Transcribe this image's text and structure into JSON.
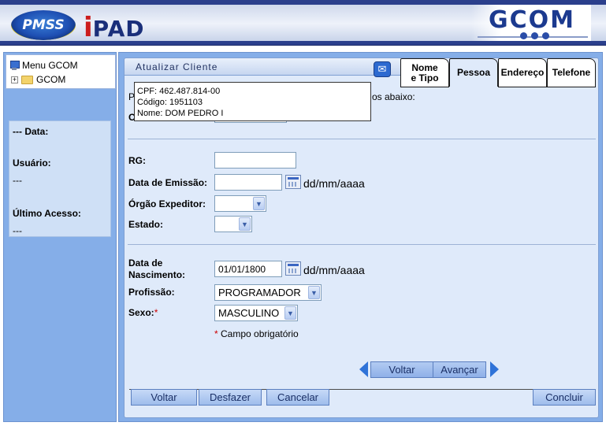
{
  "header": {
    "left_logo": "PMSS",
    "app_logo_i": "i",
    "app_logo_rest": "PAD",
    "right_logo": "GCOM"
  },
  "sidebar": {
    "tree": [
      {
        "label": "Menu GCOM",
        "icon": "computer-icon"
      },
      {
        "label": "GCOM",
        "icon": "folder-icon",
        "expander": "+"
      }
    ],
    "info": {
      "data_label": "--- Data:",
      "usuario_label": "Usuário:",
      "usuario_value": "---",
      "ultimo_label": "Último Acesso:",
      "ultimo_value": "---"
    }
  },
  "main": {
    "title": "Atualizar Cliente",
    "tabs": [
      {
        "label_line1": "Nome",
        "label_line2": "e Tipo"
      },
      {
        "label_line1": "Pessoa",
        "label_line2": ""
      },
      {
        "label_line1": "Endereço",
        "label_line2": ""
      },
      {
        "label_line1": "Telefone",
        "label_line2": ""
      }
    ],
    "active_tab": "Pessoa",
    "partial_intro_left": "P",
    "partial_intro_right": "os abaixo:",
    "partial_label_c": "C",
    "tooltip": {
      "cpf": "CPF: 462.487.814-00",
      "codigo": "Código: 1951103",
      "nome": "Nome: DOM PEDRO I"
    },
    "form": {
      "rg_label": "RG:",
      "rg_value": "",
      "emissao_label": "Data de Emissão:",
      "emissao_value": "",
      "emissao_hint": "dd/mm/aaaa",
      "orgao_label": "Órgão Expeditor:",
      "orgao_value": "",
      "estado_label": "Estado:",
      "estado_value": "",
      "nascimento_label_1": "Data de",
      "nascimento_label_2": "Nascimento:",
      "nascimento_value": "01/01/1800",
      "nascimento_hint": "dd/mm/aaaa",
      "profissao_label": "Profissão:",
      "profissao_value": "PROGRAMADOR",
      "sexo_label": "Sexo:",
      "sexo_required": "*",
      "sexo_value": "MASCULINO",
      "required_note_star": "*",
      "required_note": "Campo obrigatório"
    },
    "wizard_buttons": {
      "back": "Voltar",
      "next": "Avançar"
    },
    "bottom_buttons": {
      "voltar": "Voltar",
      "desfazer": "Desfazer",
      "cancelar": "Cancelar",
      "concluir": "Concluir"
    }
  },
  "colors": {
    "panel_blue": "#85aee8",
    "content_bg": "#dfeafa",
    "arrow_blue": "#2f73d8",
    "required_red": "#cc0000"
  }
}
